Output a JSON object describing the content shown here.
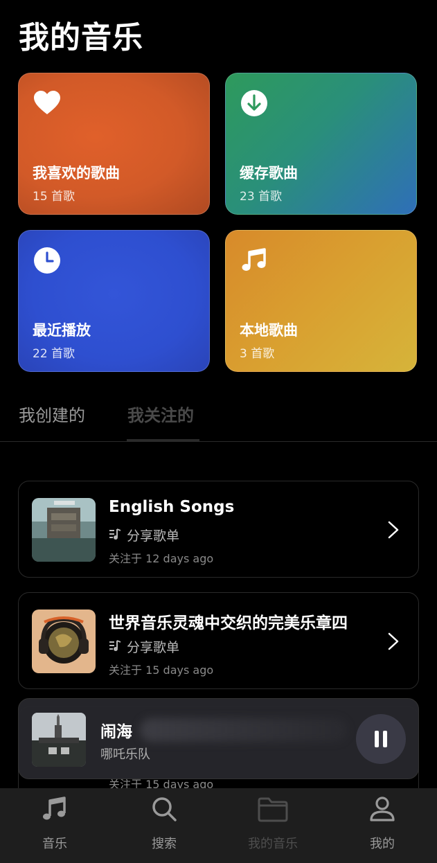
{
  "page_title": "我的音乐",
  "tiles": [
    {
      "name": "我喜欢的歌曲",
      "count": "15 首歌",
      "icon": "heart-icon"
    },
    {
      "name": "缓存歌曲",
      "count": "23 首歌",
      "icon": "download-icon"
    },
    {
      "name": "最近播放",
      "count": "22 首歌",
      "icon": "clock-icon"
    },
    {
      "name": "本地歌曲",
      "count": "3 首歌",
      "icon": "music-note-icon"
    }
  ],
  "tabs": [
    {
      "label": "我创建的",
      "active": false
    },
    {
      "label": "我关注的",
      "active": true
    }
  ],
  "playlists": [
    {
      "name": "English Songs",
      "share_label": "分享歌单",
      "followed": "关注于 12 days ago"
    },
    {
      "name": "世界音乐灵魂中交织的完美乐章四",
      "share_label": "分享歌单",
      "followed": "关注于 15 days ago"
    },
    {
      "name": "",
      "share_label": "",
      "followed": "关注于 15 days ago"
    }
  ],
  "now_playing": {
    "title": "闹海",
    "artist": "哪吒乐队",
    "state": "playing"
  },
  "nav": [
    {
      "label": "音乐",
      "icon": "music-note-icon"
    },
    {
      "label": "搜索",
      "icon": "search-icon"
    },
    {
      "label": "我的音乐",
      "icon": "folder-icon",
      "active": true
    },
    {
      "label": "我的",
      "icon": "user-icon"
    }
  ],
  "colors": {
    "background": "#000000",
    "nav_background": "#1e1e1e",
    "player_background": "#26262c"
  }
}
